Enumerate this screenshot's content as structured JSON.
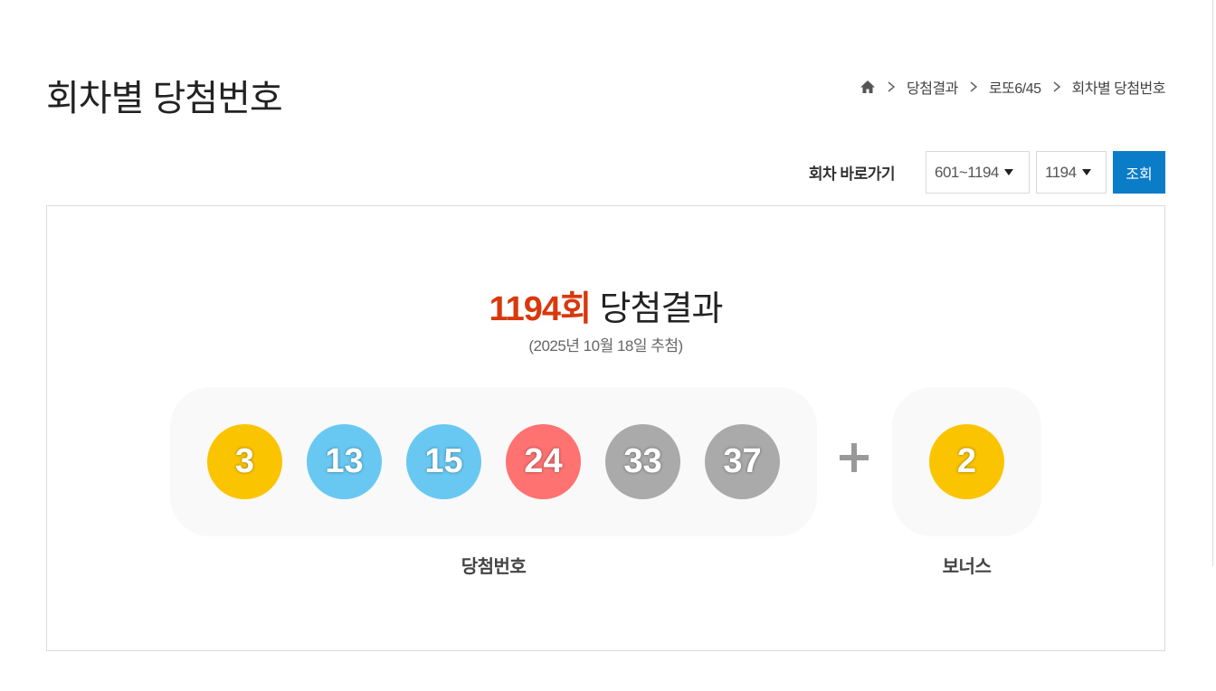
{
  "page": {
    "title": "회차별 당첨번호"
  },
  "breadcrumb": {
    "home_icon": "home-icon",
    "items": [
      "당첨결과",
      "로또6/45",
      "회차별 당첨번호"
    ]
  },
  "round_nav": {
    "label": "회차 바로가기",
    "range_select": "601~1194",
    "round_select": "1194",
    "search_button": "조회"
  },
  "result": {
    "round_number": "1194회",
    "title_suffix": " 당첨결과",
    "date": "(2025년 10월 18일 추첨)",
    "winning_label": "당첨번호",
    "bonus_label": "보너스",
    "winning_numbers": [
      {
        "value": "3",
        "color": "#fbc400"
      },
      {
        "value": "13",
        "color": "#69c8f2"
      },
      {
        "value": "15",
        "color": "#69c8f2"
      },
      {
        "value": "24",
        "color": "#ff7272"
      },
      {
        "value": "33",
        "color": "#aaaaaa"
      },
      {
        "value": "37",
        "color": "#aaaaaa"
      }
    ],
    "bonus_number": {
      "value": "2",
      "color": "#fbc400"
    }
  },
  "colors": {
    "accent": "#d8380c",
    "button": "#0a7cc8"
  }
}
